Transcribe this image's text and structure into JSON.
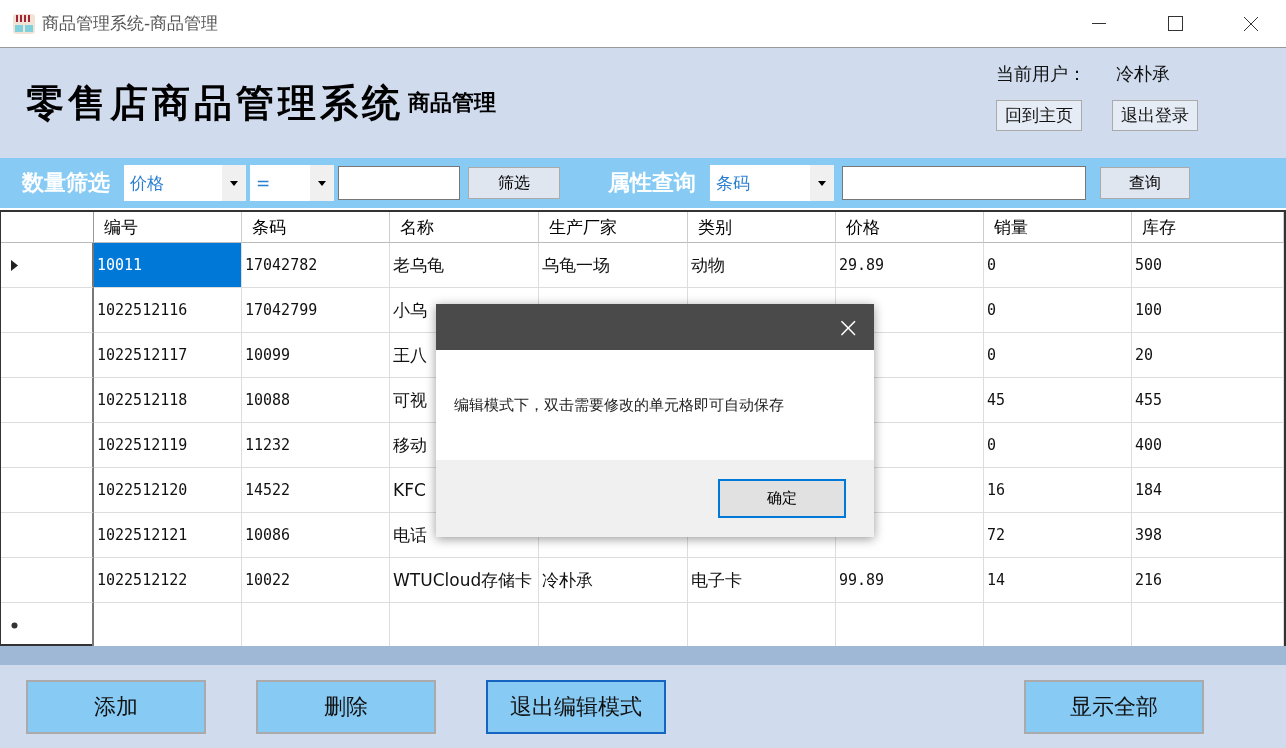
{
  "window": {
    "title": "商品管理系统-商品管理"
  },
  "header": {
    "title": "零售店商品管理系统",
    "subtitle": "商品管理",
    "user_label": "当前用户：",
    "user_name": "冷朴承",
    "buttons": [
      "回到主页",
      "退出登录"
    ]
  },
  "filter_bar": {
    "label": "数量筛选",
    "field_select": "价格",
    "operator_select": "=",
    "button": "筛选"
  },
  "query_bar": {
    "label": "属性查询",
    "field_select": "条码",
    "button": "查询"
  },
  "table": {
    "columns": [
      "编号",
      "条码",
      "名称",
      "生产厂家",
      "类别",
      "价格",
      "销量",
      "库存"
    ],
    "rows": [
      {
        "selected": true,
        "cells": [
          "10011",
          "17042782",
          "老乌龟",
          "乌龟一场",
          "动物",
          "29.89",
          "0",
          "500"
        ]
      },
      {
        "selected": false,
        "cells": [
          "1022512116",
          "17042799",
          "小乌",
          null,
          null,
          null,
          "0",
          "100"
        ]
      },
      {
        "selected": false,
        "cells": [
          "1022512117",
          "10099",
          "王八",
          null,
          null,
          null,
          "0",
          "20"
        ]
      },
      {
        "selected": false,
        "cells": [
          "1022512118",
          "10088",
          "可视",
          null,
          null,
          null,
          "45",
          "455"
        ]
      },
      {
        "selected": false,
        "cells": [
          "1022512119",
          "11232",
          "移动",
          null,
          null,
          null,
          "0",
          "400"
        ]
      },
      {
        "selected": false,
        "cells": [
          "1022512120",
          "14522",
          "KFC",
          null,
          null,
          null,
          "16",
          "184"
        ]
      },
      {
        "selected": false,
        "cells": [
          "1022512121",
          "10086",
          "电话",
          null,
          null,
          null,
          "72",
          "398"
        ]
      },
      {
        "selected": false,
        "cells": [
          "1022512122",
          "10022",
          "WTUCloud存储卡",
          "冷朴承",
          "电子卡",
          "99.89",
          "14",
          "216"
        ]
      }
    ],
    "new_row": true
  },
  "bottom_buttons": [
    {
      "label": "添加",
      "focused": false
    },
    {
      "label": "删除",
      "focused": false
    },
    {
      "label": "退出编辑模式",
      "focused": true
    },
    {
      "label": "显示全部",
      "focused": false
    }
  ],
  "dialog": {
    "message": "编辑模式下，双击需要修改的单元格即可自动保存",
    "button": "确定",
    "close": "×"
  }
}
